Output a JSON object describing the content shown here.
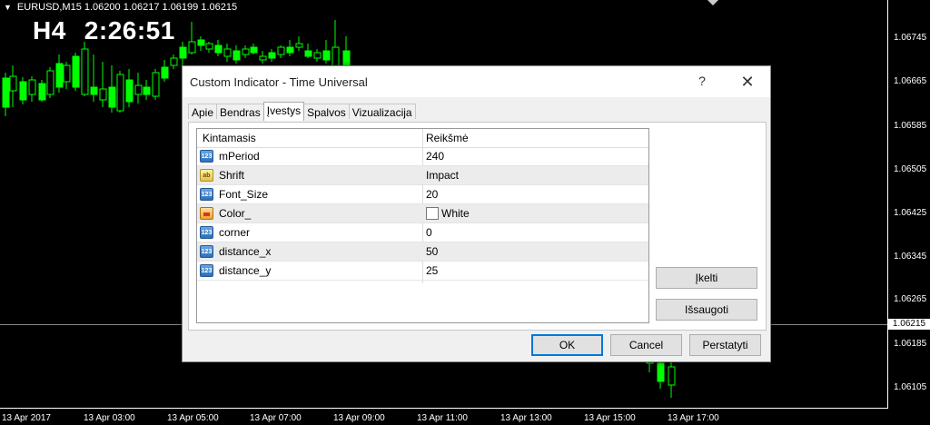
{
  "chart": {
    "symbol_line": "EURUSD,M15  1.06200 1.06217 1.06199 1.06215",
    "timeframe": "H4",
    "timer": "2:26:51",
    "bid_tag": "1.06215",
    "price_labels": [
      "1.06745",
      "1.06665",
      "1.06585",
      "1.06505",
      "1.06425",
      "1.06345",
      "1.06265",
      "1.06185",
      "1.06105"
    ],
    "time_labels": [
      "13 Apr 2017",
      "13 Apr 03:00",
      "13 Apr 05:00",
      "13 Apr 07:00",
      "13 Apr 09:00",
      "13 Apr 11:00",
      "13 Apr 13:00",
      "13 Apr 15:00",
      "13 Apr 17:00"
    ]
  },
  "dialog": {
    "title": "Custom Indicator - Time Universal",
    "help_glyph": "?",
    "close_glyph": "✕",
    "tabs": [
      "Apie",
      "Bendras",
      "Įvestys",
      "Spalvos",
      "Vizualizacija"
    ],
    "active_tab": "Įvestys",
    "grid": {
      "col_name": "Kintamasis",
      "col_value": "Reikšmė",
      "rows": [
        {
          "icon": "number-type-icon",
          "name": "mPeriod",
          "value": "240"
        },
        {
          "icon": "string-type-icon",
          "name": "Shrift",
          "value": "Impact"
        },
        {
          "icon": "number-type-icon",
          "name": "Font_Size",
          "value": "20"
        },
        {
          "icon": "color-type-icon",
          "name": "Color_",
          "value": "White",
          "swatch": "#ffffff"
        },
        {
          "icon": "number-type-icon",
          "name": "corner",
          "value": "0"
        },
        {
          "icon": "number-type-icon",
          "name": "distance_x",
          "value": "50"
        },
        {
          "icon": "number-type-icon",
          "name": "distance_y",
          "value": "25"
        }
      ]
    },
    "buttons": {
      "load": "Įkelti",
      "save": "Išsaugoti",
      "ok": "OK",
      "cancel": "Cancel",
      "reset": "Perstatyti"
    }
  },
  "colors": {
    "chart_bg": "#000000",
    "candle": "#00ff00",
    "accent": "#0078d7"
  }
}
